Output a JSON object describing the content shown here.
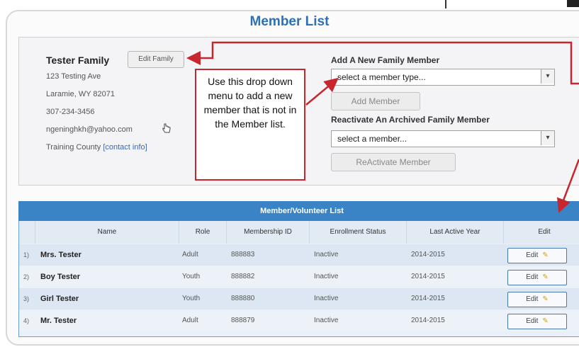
{
  "page": {
    "title": "Member List"
  },
  "family": {
    "name": "Tester Family",
    "edit_label": "Edit Family",
    "address1": "123 Testing Ave",
    "address2": "Laramie, WY 82071",
    "phone": "307-234-3456",
    "email": "ngeninghkh@yahoo.com",
    "county": "Training County",
    "contact_link": "[contact info]"
  },
  "add_member": {
    "label": "Add A New Family Member",
    "select_value": "select a member type...",
    "button": "Add Member"
  },
  "reactivate": {
    "label": "Reactivate An Archived Family Member",
    "select_value": "select a member...",
    "button": "ReActivate Member"
  },
  "callout": {
    "text": "Use this drop down menu to add a new member that is not in the Member list."
  },
  "table": {
    "title": "Member/Volunteer List",
    "columns": [
      "Name",
      "Role",
      "Membership ID",
      "Enrollment Status",
      "Last Active Year",
      "Edit"
    ],
    "rows": [
      {
        "num": "1)",
        "name": "Mrs. Tester",
        "role": "Adult",
        "id": "888883",
        "status": "Inactive",
        "year": "2014-2015",
        "edit": "Edit"
      },
      {
        "num": "2)",
        "name": "Boy Tester",
        "role": "Youth",
        "id": "888882",
        "status": "Inactive",
        "year": "2014-2015",
        "edit": "Edit"
      },
      {
        "num": "3)",
        "name": "Girl Tester",
        "role": "Youth",
        "id": "888880",
        "status": "Inactive",
        "year": "2014-2015",
        "edit": "Edit"
      },
      {
        "num": "4)",
        "name": "Mr. Tester",
        "role": "Adult",
        "id": "888879",
        "status": "Inactive",
        "year": "2014-2015",
        "edit": "Edit"
      }
    ]
  },
  "icons": {
    "dropdown": "chevron-down-icon",
    "edit_pencil": "pencil-icon",
    "cursor": "hand-pointer-icon"
  },
  "colors": {
    "title_blue": "#2f6fb5",
    "header_blue": "#3a84c6",
    "annotation_red": "#c8262e"
  }
}
